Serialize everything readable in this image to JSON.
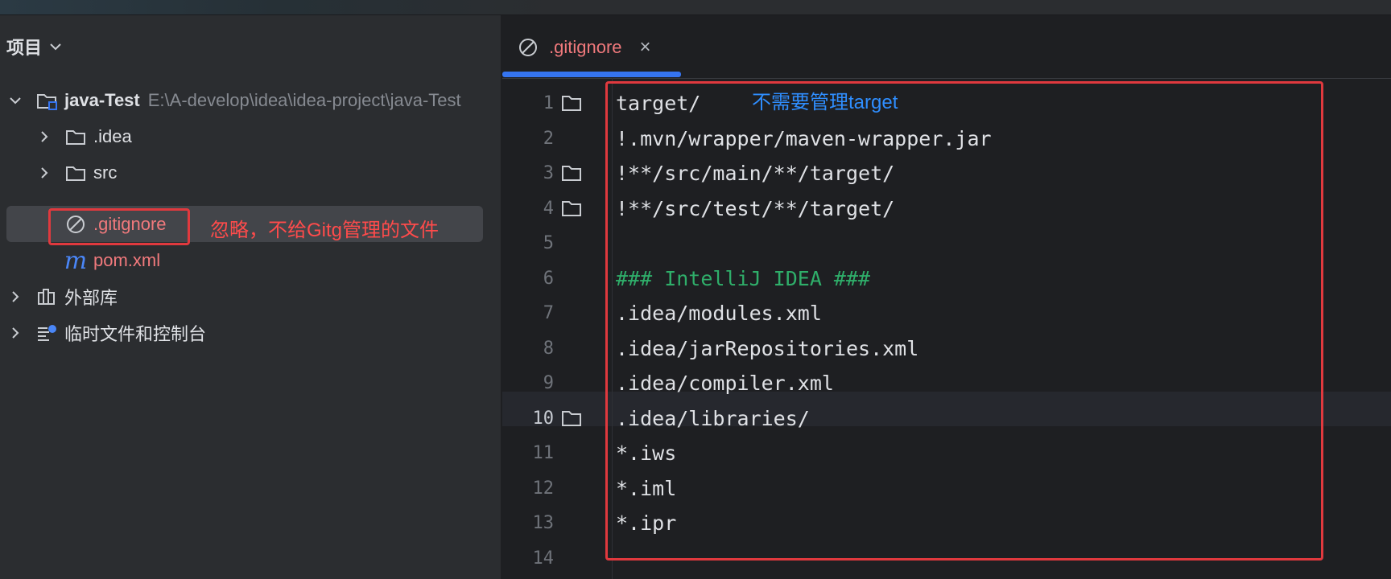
{
  "project_panel": {
    "title": "项目",
    "root": {
      "name": "java-Test",
      "path": "E:\\A-develop\\idea\\idea-project\\java-Test"
    },
    "items": [
      {
        "label": ".idea",
        "icon": "folder-icon"
      },
      {
        "label": "src",
        "icon": "folder-icon"
      },
      {
        "label": ".gitignore",
        "icon": "ignored-file-icon"
      },
      {
        "label": "pom.xml",
        "icon": "maven-m-icon"
      },
      {
        "label": "外部库",
        "icon": "library-icon"
      },
      {
        "label": "临时文件和控制台",
        "icon": "scratches-icon"
      }
    ]
  },
  "annotations": {
    "gitignore_note": "忽略，不给Gitg管理的文件",
    "target_note": "不需要管理target"
  },
  "editor": {
    "active_tab": ".gitignore",
    "tab_close": "×",
    "current_line": 10,
    "lines": [
      {
        "n": "1",
        "text": "target/",
        "fold": true
      },
      {
        "n": "2",
        "text": "!.mvn/wrapper/maven-wrapper.jar",
        "fold": false
      },
      {
        "n": "3",
        "text": "!**/src/main/**/target/",
        "fold": true
      },
      {
        "n": "4",
        "text": "!**/src/test/**/target/",
        "fold": true
      },
      {
        "n": "5",
        "text": "",
        "fold": false
      },
      {
        "n": "6",
        "text": "### IntelliJ IDEA ###",
        "fold": false,
        "comment": true
      },
      {
        "n": "7",
        "text": ".idea/modules.xml",
        "fold": false
      },
      {
        "n": "8",
        "text": ".idea/jarRepositories.xml",
        "fold": false
      },
      {
        "n": "9",
        "text": ".idea/compiler.xml",
        "fold": false
      },
      {
        "n": "10",
        "text": ".idea/libraries/",
        "fold": true
      },
      {
        "n": "11",
        "text": "*.iws",
        "fold": false
      },
      {
        "n": "12",
        "text": "*.iml",
        "fold": false
      },
      {
        "n": "13",
        "text": "*.ipr",
        "fold": false
      },
      {
        "n": "14",
        "text": "",
        "fold": false
      }
    ]
  },
  "colors": {
    "accent": "#3574f0",
    "ignored_text": "#f0797c",
    "comment": "#2fae6a",
    "annotation_red": "#ff4b4b",
    "annotation_blue": "#2f8eff",
    "highlight_box": "#e0393e"
  }
}
